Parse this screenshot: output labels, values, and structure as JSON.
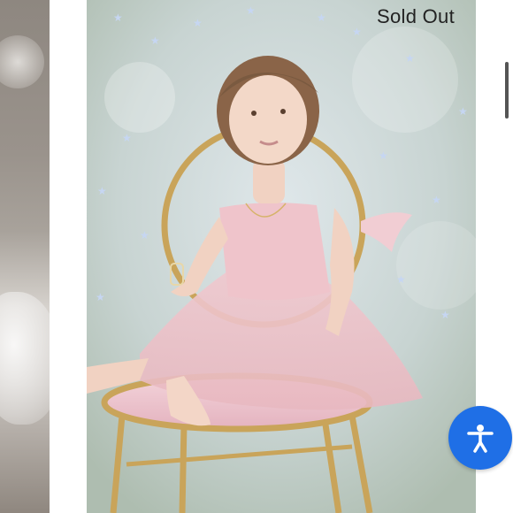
{
  "status": {
    "sold_out_label": "Sold Out"
  },
  "gallery": {
    "left_image": {
      "icon": "photo-thumbnail"
    },
    "main_image": {
      "icon": "product-photo"
    }
  },
  "accessibility": {
    "icon": "accessibility-person-icon",
    "color": "#1f6fe6"
  },
  "scrollbar": {
    "color": "#555555"
  }
}
